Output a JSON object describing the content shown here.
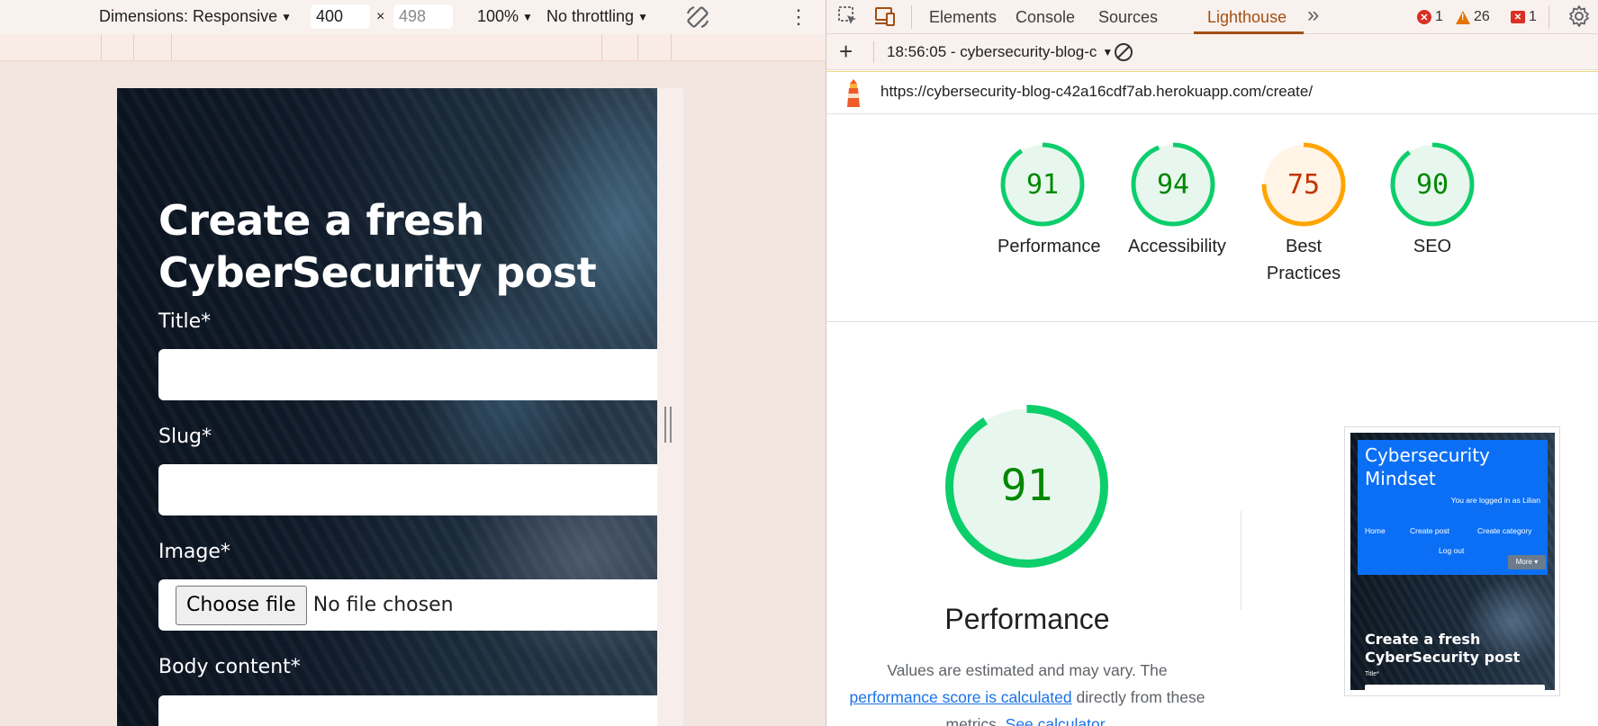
{
  "device_toolbar": {
    "dimensions_label": "Dimensions: Responsive",
    "width_value": "400",
    "height_placeholder": "498",
    "times": "×",
    "zoom": "100%",
    "throttling": "No throttling",
    "rotate_icon": "rotate-icon",
    "more_icon": "kebab-menu-icon"
  },
  "page": {
    "heading": "Create a fresh CyberSecurity post",
    "title_label": "Title*",
    "slug_label": "Slug*",
    "image_label": "Image*",
    "choose_file": "Choose file",
    "no_file": "No file chosen",
    "body_label": "Body content*"
  },
  "devtools": {
    "tabs": [
      "Elements",
      "Console",
      "Sources",
      "Lighthouse"
    ],
    "active_tab": "Lighthouse",
    "more_tabs": "»",
    "errors": "1",
    "warnings": "26",
    "issues": "1",
    "report_label": "18:56:05 - cybersecurity-blog-c",
    "url": "https://cybersecurity-blog-c42a16cdf7ab.herokuapp.com/create/"
  },
  "scores": [
    {
      "label": "Performance",
      "value": "91",
      "color": "#0cce6b",
      "text_color": "#008800",
      "bg": "#e7f7ee"
    },
    {
      "label": "Accessibility",
      "value": "94",
      "color": "#0cce6b",
      "text_color": "#008800",
      "bg": "#e7f7ee"
    },
    {
      "label": "Best Practices",
      "value": "75",
      "color": "#ffa400",
      "text_color": "#c33300",
      "bg": "#fff4e5"
    },
    {
      "label": "SEO",
      "value": "90",
      "color": "#0cce6b",
      "text_color": "#008800",
      "bg": "#e7f7ee"
    }
  ],
  "performance": {
    "value": "91",
    "title": "Performance",
    "note_1": "Values are estimated and may vary. The",
    "link_1": "performance score is calculated",
    "note_2": "directly from these",
    "note_3": "metrics.",
    "link_2": "See calculator."
  },
  "thumbnail": {
    "brand": "Cybersecurity Mindset",
    "logged": "You are logged in as Lilian",
    "nav": [
      "Home",
      "Create post",
      "Create category",
      "Log out"
    ],
    "more": "More ▾",
    "heading": "Create a fresh CyberSecurity post",
    "title": "Title*"
  }
}
